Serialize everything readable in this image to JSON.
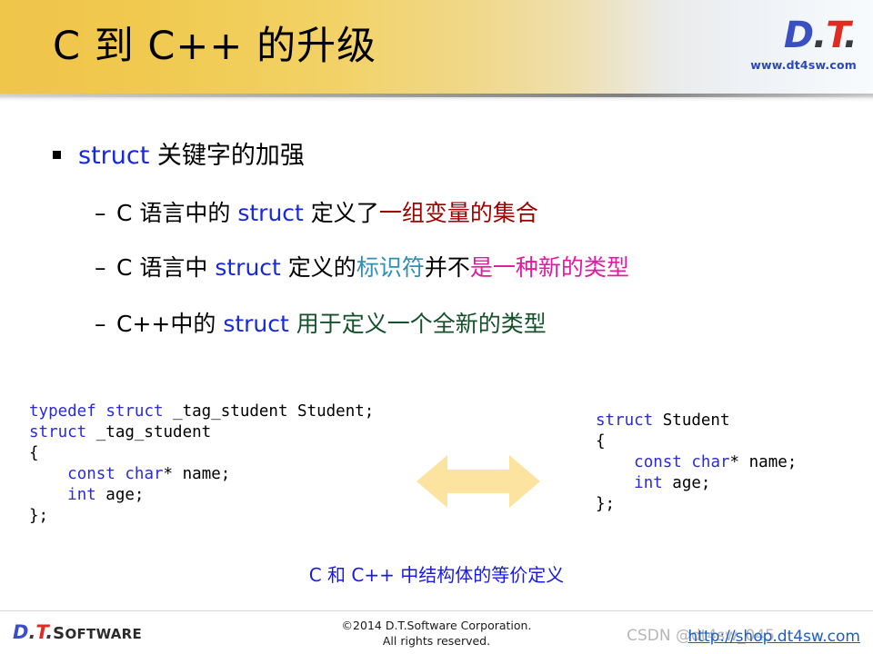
{
  "header": {
    "title": "C 到 C++ 的升级",
    "logo": {
      "d": "D",
      "dot1": ".",
      "t": "T",
      "dot2": ".",
      "url": "www.dt4sw.com"
    },
    "accent_gold": "#efc54a",
    "accent_blue": "#3b4fc4",
    "accent_red": "#e02b22"
  },
  "bullets": {
    "level1": {
      "keyword": "struct",
      "text": " 关键字的加强"
    },
    "level2": [
      {
        "dash": "–",
        "pre": "C 语言中的 ",
        "keyword": "struct",
        "mid": " 定义了",
        "highlight": "一组变量的集合",
        "highlight_color": "#9e0000"
      },
      {
        "dash": "–",
        "pre": "C 语言中 ",
        "keyword": "struct",
        "mid": " 定义的",
        "accent1": "标识符",
        "accent1_color": "#2f8fb5",
        "mid2": "并不",
        "highlight": "是一种新的类型",
        "highlight_color": "#e21ba0"
      },
      {
        "dash": "–",
        "pre": "C++中的 ",
        "keyword": "struct",
        "mid": " ",
        "highlight": "用于定义一个全新的类型",
        "highlight_color": "#14502a"
      }
    ]
  },
  "code": {
    "left_lines": [
      [
        {
          "t": "typedef",
          "k": true
        },
        {
          "t": " ",
          "k": false
        },
        {
          "t": "struct",
          "k": true
        },
        {
          "t": " _tag_student Student;",
          "k": false
        }
      ],
      [
        {
          "t": "struct",
          "k": true
        },
        {
          "t": " _tag_student",
          "k": false
        }
      ],
      [
        {
          "t": "{",
          "k": false
        }
      ],
      [
        {
          "t": "    ",
          "k": false
        },
        {
          "t": "const",
          "k": true
        },
        {
          "t": " ",
          "k": false
        },
        {
          "t": "char",
          "k": true
        },
        {
          "t": "* name;",
          "k": false
        }
      ],
      [
        {
          "t": "    ",
          "k": false
        },
        {
          "t": "int",
          "k": true
        },
        {
          "t": " age;",
          "k": false
        }
      ],
      [
        {
          "t": "};",
          "k": false
        }
      ]
    ],
    "right_lines": [
      [
        {
          "t": "struct",
          "k": true
        },
        {
          "t": " Student",
          "k": false
        }
      ],
      [
        {
          "t": "{",
          "k": false
        }
      ],
      [
        {
          "t": "    ",
          "k": false
        },
        {
          "t": "const",
          "k": true
        },
        {
          "t": " ",
          "k": false
        },
        {
          "t": "char",
          "k": true
        },
        {
          "t": "* name;",
          "k": false
        }
      ],
      [
        {
          "t": "    ",
          "k": false
        },
        {
          "t": "int",
          "k": true
        },
        {
          "t": " age;",
          "k": false
        }
      ],
      [
        {
          "t": "};",
          "k": false
        }
      ]
    ],
    "keyword_color": "#2a2ae0",
    "caption": "C 和 C++ 中结构体的等价定义",
    "caption_color": "#1a1ae6",
    "arrow_color": "#fce3a0"
  },
  "footer": {
    "logo": {
      "d": "D",
      "dot1": ".",
      "t": "T",
      "dot2": ".",
      "word": "OFTWARE",
      "word_cap": "S"
    },
    "copyright_line1": "©2014 D.T.Software Corporation.",
    "copyright_line2": "All rights reserved.",
    "watermark": "CSDN @dt4sw_045",
    "shop_link": "http://shop.dt4sw.com"
  }
}
